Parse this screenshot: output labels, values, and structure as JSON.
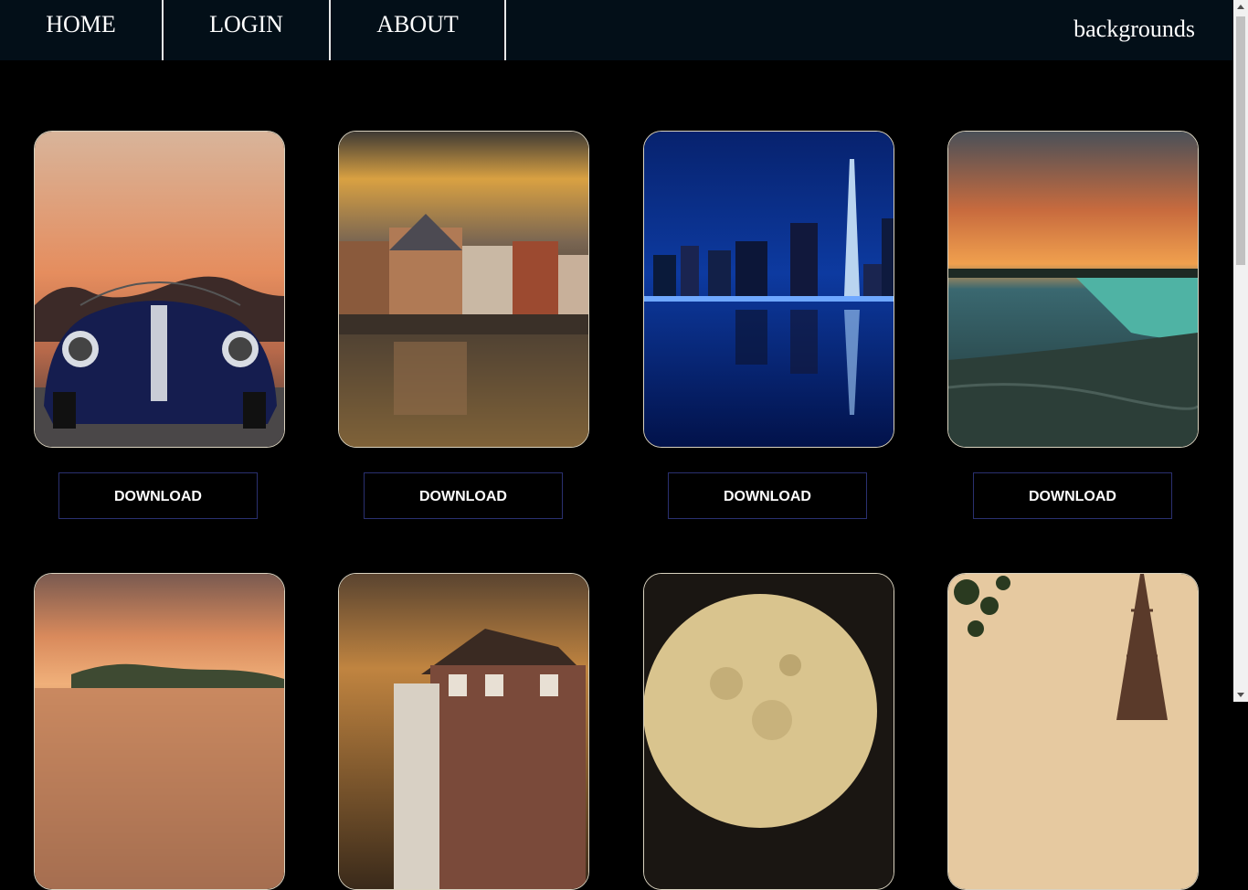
{
  "nav": {
    "items": [
      {
        "label": "HOME"
      },
      {
        "label": "LOGIN"
      },
      {
        "label": "ABOUT"
      }
    ],
    "brand": "backgrounds"
  },
  "gallery": {
    "download_label": "DOWNLOAD",
    "images": [
      {
        "subject": "vintage roadster car at sunset"
      },
      {
        "subject": "canal-side town houses reflected in water"
      },
      {
        "subject": "night city skyline reflected in water"
      },
      {
        "subject": "waterfall under sunset sky"
      },
      {
        "subject": "sunset over lake with forest"
      },
      {
        "subject": "brick houses under dramatic clouds"
      },
      {
        "subject": "full moon"
      },
      {
        "subject": "eiffel tower with leaves"
      }
    ]
  },
  "colors": {
    "navbar_bg": "#030f18",
    "page_bg": "#000000",
    "button_border": "#2a3070"
  }
}
